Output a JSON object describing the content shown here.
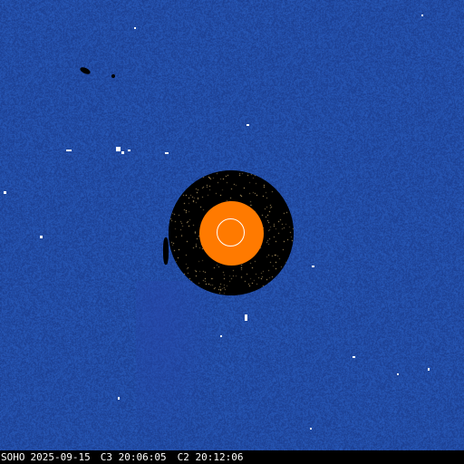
{
  "status_bar": {
    "observatory": "SOHO",
    "date": "2025-09-15",
    "c3_time": "C3 20:06:05",
    "c2_time": "C2 20:12:06"
  },
  "colors": {
    "background_field": "#1c3aa0",
    "occulter": "#000000",
    "sun_disk": "#ff7a00",
    "limb_circle": "#ffffff",
    "status_bar_bg": "#000000",
    "status_bar_text": "#ffffff"
  }
}
